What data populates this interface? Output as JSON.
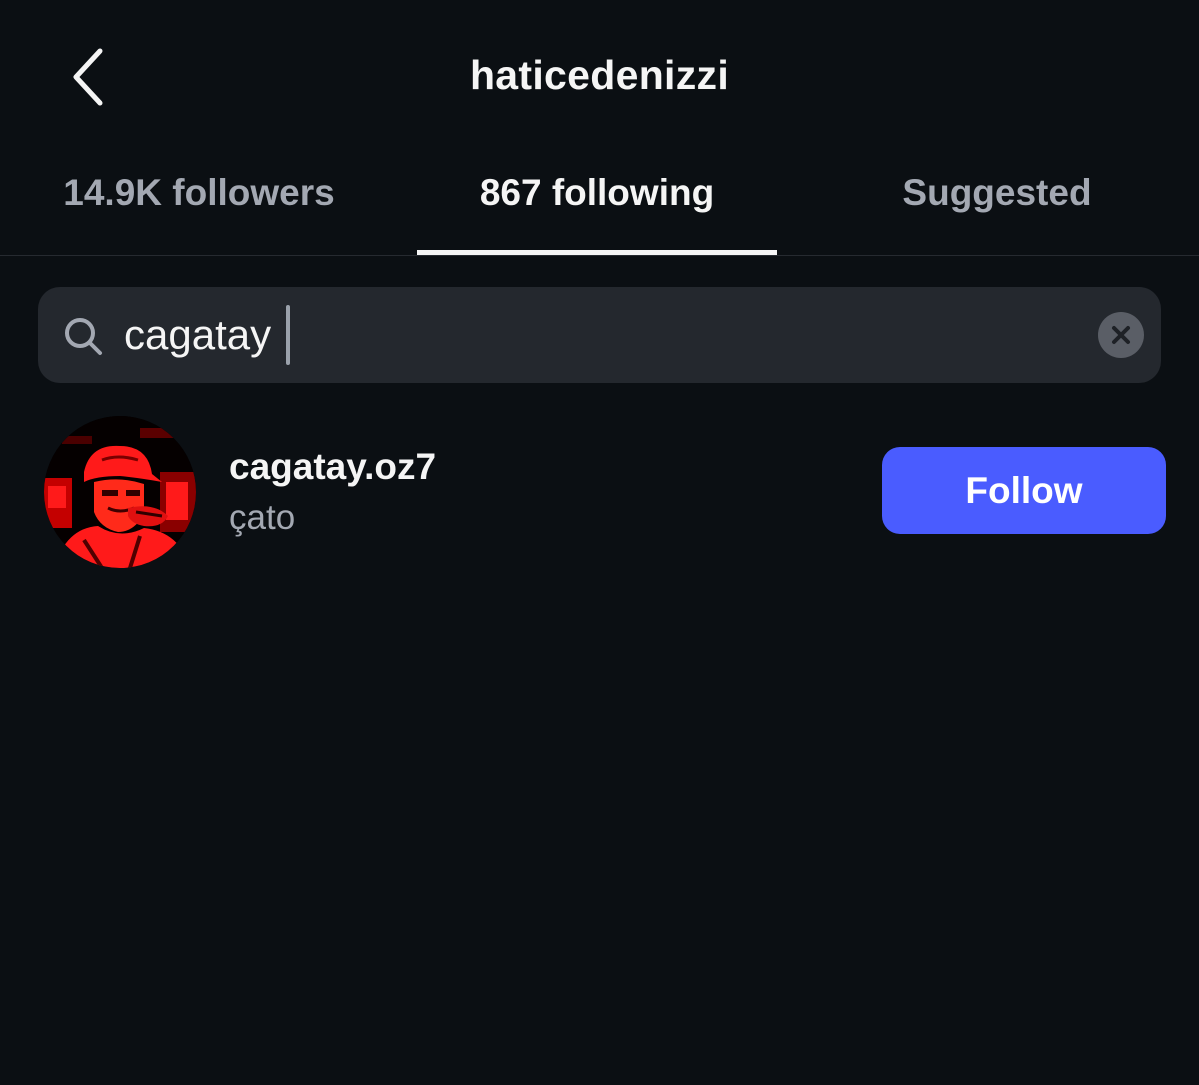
{
  "header": {
    "title": "haticedenizzi",
    "back_icon": "chevron-left-icon"
  },
  "tabs": [
    {
      "label": "14.9K followers",
      "active": false
    },
    {
      "label": "867 following",
      "active": true
    },
    {
      "label": "Suggested",
      "active": false
    }
  ],
  "search": {
    "value": "cagatay",
    "search_icon": "search-icon",
    "clear_icon": "clear-icon"
  },
  "results": [
    {
      "username": "cagatay.oz7",
      "full_name": "çato",
      "button_label": "Follow"
    }
  ],
  "colors": {
    "background": "#0b0f13",
    "search_field": "#24282e",
    "follow_button": "#4a5cff",
    "text_primary": "#f5f5f5",
    "text_secondary": "#a3a8b2",
    "avatar_tint": "#ff1a1a"
  }
}
